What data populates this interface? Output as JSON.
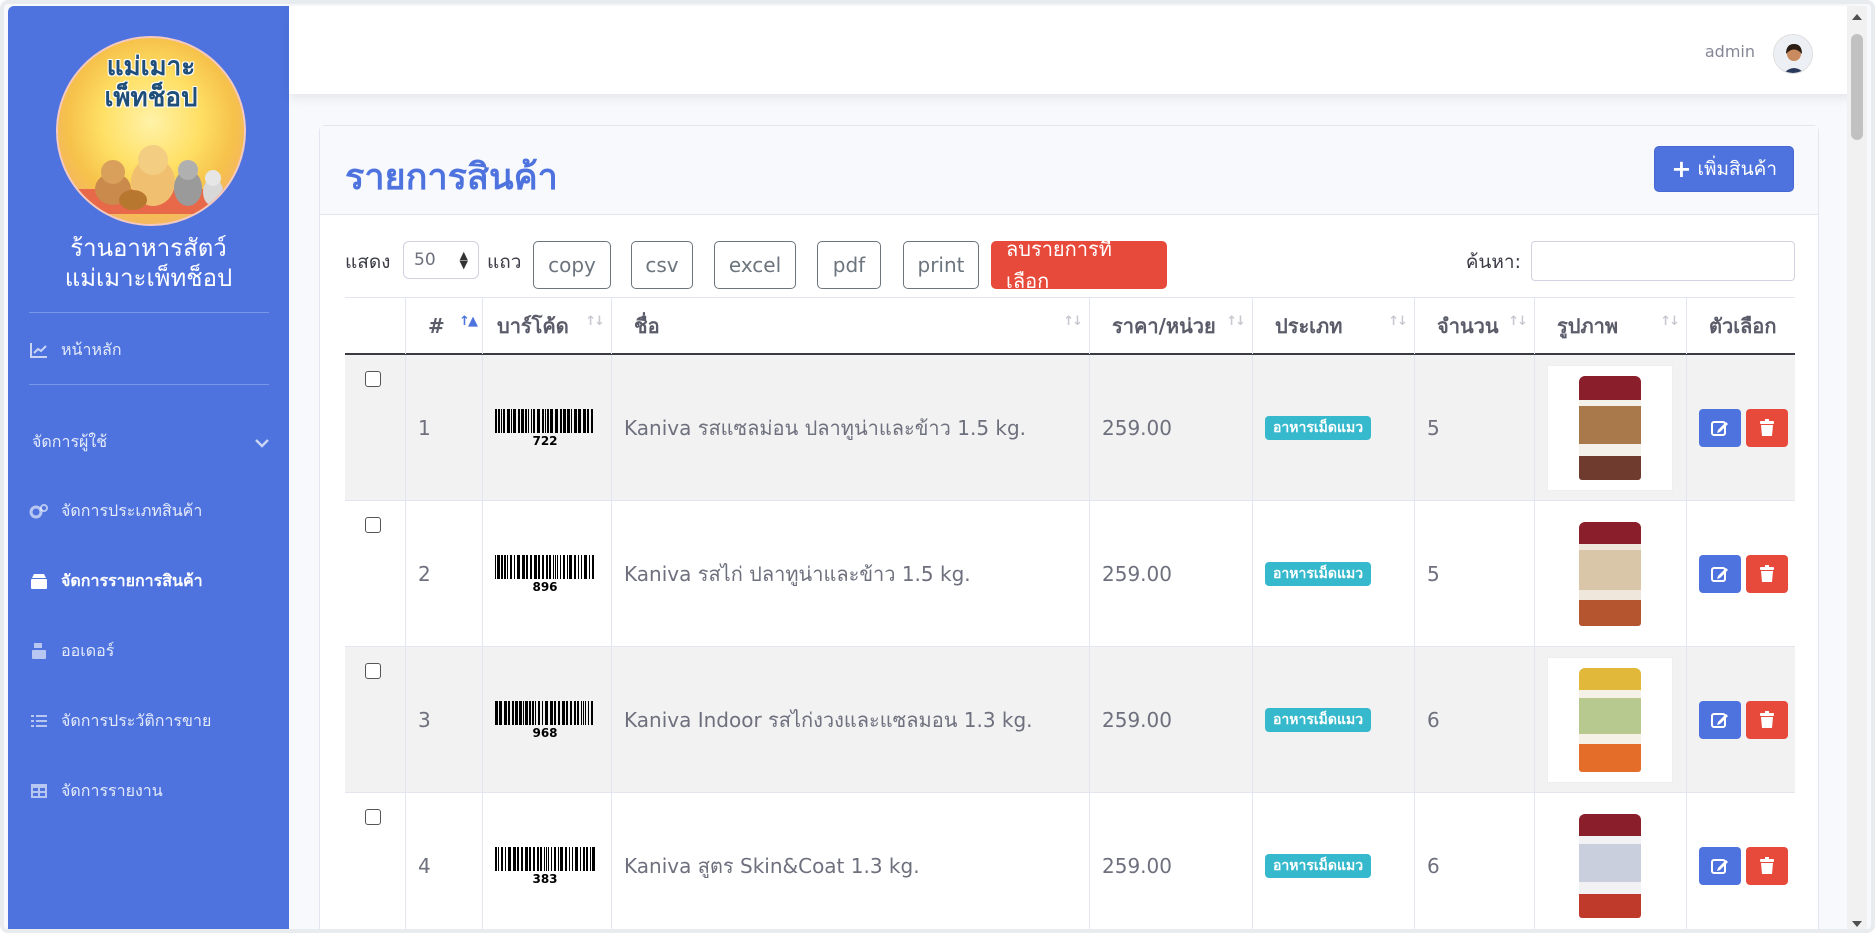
{
  "sidebar": {
    "logo_text_line1": "แม่เมาะ",
    "logo_text_line2": "เพ็ทช็อป",
    "shop_name_line1": "ร้านอาหารสัตว์",
    "shop_name_line2": "แม่เมาะเพ็ทช็อป",
    "items": [
      {
        "label": "หน้าหลัก",
        "icon": "chart-line-icon"
      },
      {
        "label": "จัดการผู้ใช้",
        "icon": "chevron-down-icon"
      },
      {
        "label": "จัดการประเภทสินค้า",
        "icon": "cogs-icon"
      },
      {
        "label": "จัดการรายการสินค้า",
        "icon": "box-icon"
      },
      {
        "label": "ออเดอร์",
        "icon": "cash-register-icon"
      },
      {
        "label": "จัดการประวัติการขาย",
        "icon": "list-icon"
      },
      {
        "label": "จัดการรายงาน",
        "icon": "table-icon"
      }
    ]
  },
  "topbar": {
    "username": "admin"
  },
  "page": {
    "title": "รายการสินค้า",
    "add_button": "เพิ่มสินค้า"
  },
  "controls": {
    "show_label": "แสดง",
    "page_length": "50",
    "rows_label": "แถว",
    "buttons": [
      "copy",
      "csv",
      "excel",
      "pdf",
      "print"
    ],
    "delete_selected": "ลบรายการที่เลือก",
    "search_label": "ค้นหา:"
  },
  "table": {
    "headers": [
      "#",
      "บาร์โค้ด",
      "ชื่อ",
      "ราคา/หน่วย",
      "ประเภท",
      "จำนวน",
      "รูปภาพ",
      "ตัวเลือก"
    ],
    "rows": [
      {
        "no": "1",
        "barcode": "722",
        "name": "Kaniva รสแซลม่อน ปลาทูน่าและข้าว 1.5 kg.",
        "price": "259.00",
        "category": "อาหารเม็ดแมว",
        "qty": "5"
      },
      {
        "no": "2",
        "barcode": "896",
        "name": "Kaniva รสไก่ ปลาทูน่าและข้าว 1.5 kg.",
        "price": "259.00",
        "category": "อาหารเม็ดแมว",
        "qty": "5"
      },
      {
        "no": "3",
        "barcode": "968",
        "name": "Kaniva Indoor รสไก่งวงและแซลมอน 1.3 kg.",
        "price": "259.00",
        "category": "อาหารเม็ดแมว",
        "qty": "6"
      },
      {
        "no": "4",
        "barcode": "383",
        "name": "Kaniva สูตร Skin&Coat 1.3 kg.",
        "price": "259.00",
        "category": "อาหารเม็ดแมว",
        "qty": "6"
      }
    ]
  },
  "colors": {
    "primary": "#4e73df",
    "danger": "#e74a3b",
    "info": "#36b9cc"
  }
}
